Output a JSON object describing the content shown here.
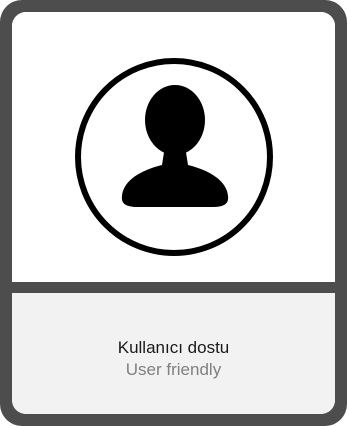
{
  "icon": {
    "name": "user-icon",
    "color": "#000000"
  },
  "caption": {
    "primary": "Kullanıcı dostu",
    "secondary": "User friendly"
  },
  "colors": {
    "frame": "#4d4d4d",
    "caption_background": "#f2f2f2",
    "primary_text": "#1a1a1a",
    "secondary_text": "#808080"
  }
}
